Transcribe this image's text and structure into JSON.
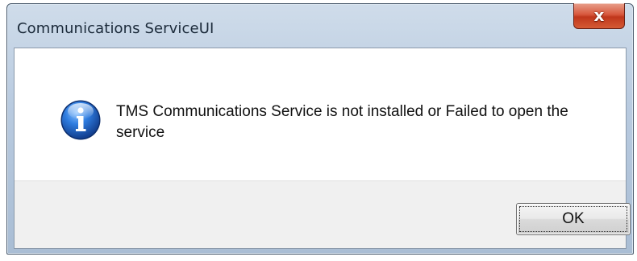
{
  "window": {
    "title": "Communications ServiceUI",
    "close_label": "x"
  },
  "message": {
    "icon": "info-icon",
    "text": "TMS Communications Service is not installed or Failed to open the service"
  },
  "buttons": {
    "ok_label": "OK"
  },
  "colors": {
    "info_icon_blue": "#1f5fbf",
    "close_button_red": "#c0371c",
    "footer_gray": "#f0f0f0"
  }
}
